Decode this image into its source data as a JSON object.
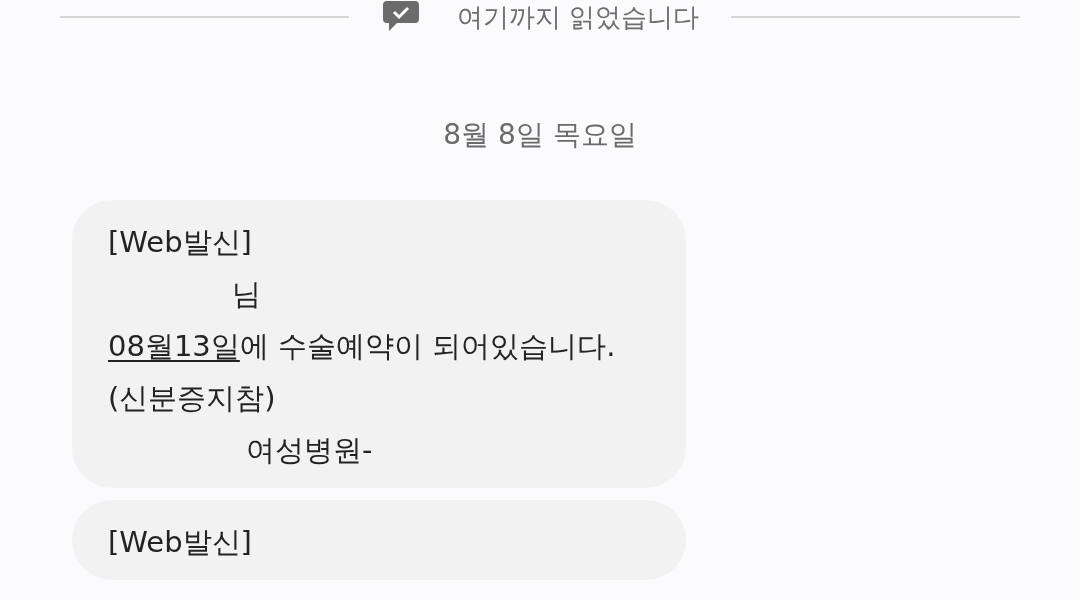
{
  "read_marker": {
    "label": "여기까지 읽었습니다"
  },
  "date_header": "8월 8일 목요일",
  "messages": [
    {
      "lines": [
        {
          "kind": "plain",
          "parts": [
            {
              "text": "[Web발신]",
              "underlined": false
            }
          ]
        },
        {
          "kind": "indented",
          "parts": [
            {
              "text": "님",
              "underlined": false
            }
          ]
        },
        {
          "kind": "plain",
          "parts": [
            {
              "text": "08월13일",
              "underlined": true
            },
            {
              "text": "에 수술예약이 되어있습니다.",
              "underlined": false
            }
          ]
        },
        {
          "kind": "plain",
          "parts": [
            {
              "text": "(신분증지참)",
              "underlined": false
            }
          ]
        },
        {
          "kind": "indented_more",
          "parts": [
            {
              "text": "여성병원-",
              "underlined": false
            }
          ]
        }
      ]
    },
    {
      "lines": [
        {
          "kind": "plain",
          "parts": [
            {
              "text": "[Web발신]",
              "underlined": false
            }
          ]
        }
      ]
    }
  ]
}
